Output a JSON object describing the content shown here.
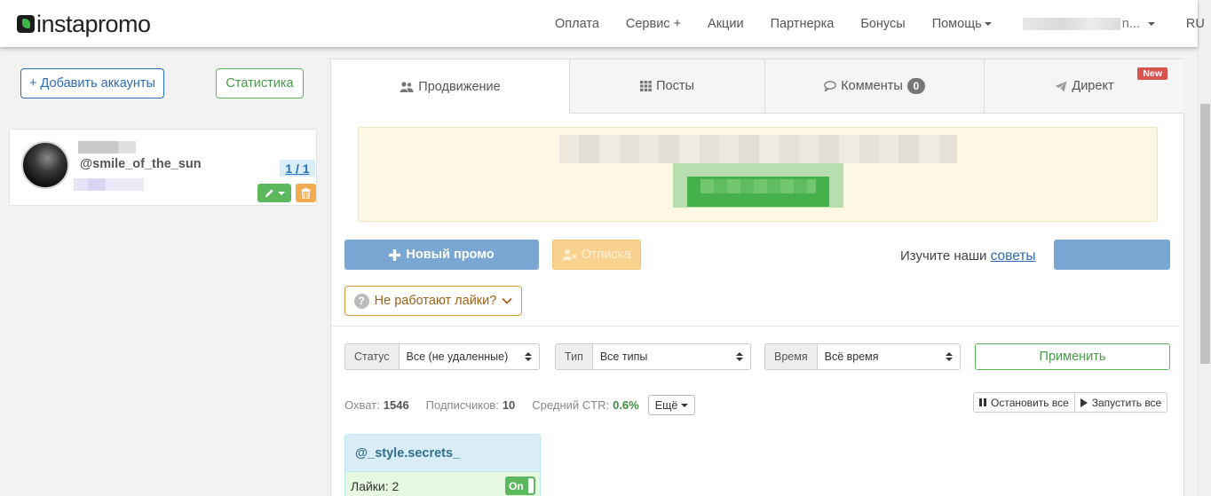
{
  "brand": {
    "name": "instapromo"
  },
  "nav": {
    "items": [
      "Оплата",
      "Сервис +",
      "Акции",
      "Партнерка",
      "Бонусы",
      "Помощь"
    ],
    "user_suffix": "n...",
    "language": "RU"
  },
  "left": {
    "add_accounts_label": "+ Добавить аккаунты",
    "stats_label": "Статистика",
    "account": {
      "handle": "@smile_of_the_sun",
      "count": "1 / 1"
    }
  },
  "tabs": {
    "promotion": "Продвижение",
    "posts": "Посты",
    "comments": "Комменты",
    "comments_badge": "0",
    "direct": "Директ",
    "direct_badge": "New"
  },
  "actions": {
    "new_promo": "Новый промо",
    "unsubscribe": "Отписка",
    "tips_prefix": "Изучите наши",
    "tips_link": "советы",
    "likes_help": "Не работают лайки?"
  },
  "filters": {
    "status_label": "Статус",
    "status_value": "Все (не удаленные)",
    "type_label": "Тип",
    "type_value": "Все типы",
    "time_label": "Время",
    "time_value": "Всё время",
    "apply_label": "Применить"
  },
  "stats": {
    "reach_label": "Охват:",
    "reach_value": "1546",
    "subs_label": "Подписчиков:",
    "subs_value": "10",
    "ctr_label": "Средний CTR:",
    "ctr_value": "0.6%",
    "more_label": "Ещё",
    "stop_all": "Остановить все",
    "start_all": "Запустить все"
  },
  "promo_card": {
    "handle": "@_style.secrets_",
    "likes_label": "Лайки: 2",
    "toggle_label": "On"
  },
  "colors": {
    "primary": "#2a6dbb",
    "success": "#5cb85c",
    "warning": "#f0ad4e",
    "danger": "#d9534f",
    "banner_bg": "#fcf8e3"
  },
  "icons": [
    "users-icon",
    "grid-icon",
    "comment-icon",
    "paper-plane-icon",
    "plus-icon",
    "user-remove-icon",
    "question-icon",
    "chevron-down-icon",
    "pencil-icon",
    "trash-icon",
    "pause-icon",
    "play-icon"
  ]
}
